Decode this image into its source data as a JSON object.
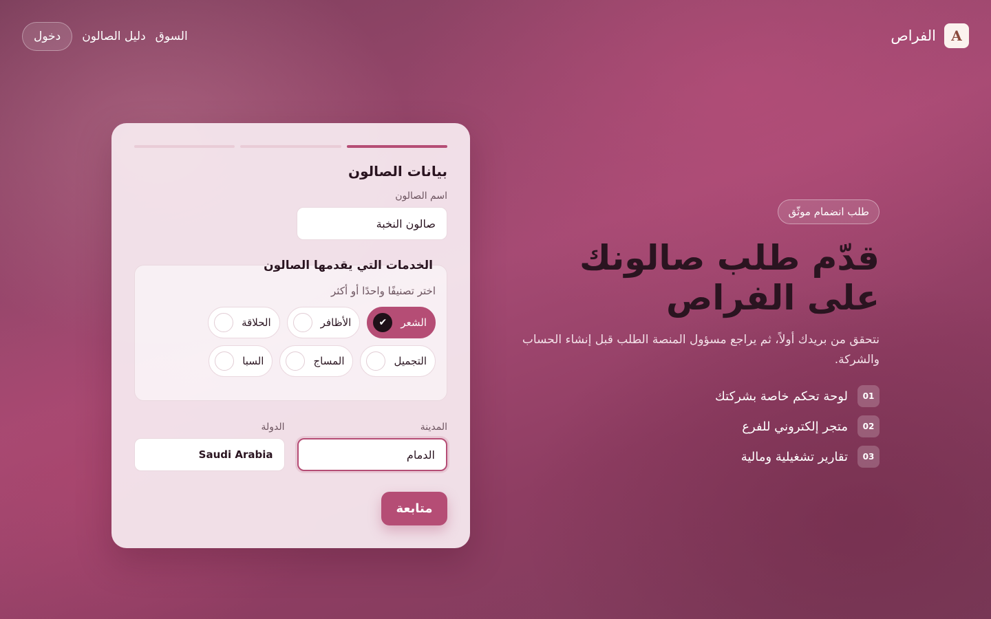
{
  "brand": {
    "name": "الفراص",
    "logo_icon": "brand-monogram-icon"
  },
  "nav": {
    "login_label": "دخول",
    "links": [
      "دليل الصالون",
      "السوق"
    ]
  },
  "hero": {
    "badge": "طلب انضمام موثّق",
    "title": "قدّم طلب صالونك على الفراص",
    "description": "نتحقق من بريدك أولاً، ثم يراجع مسؤول المنصة الطلب قبل إنشاء الحساب والشركة.",
    "features": [
      {
        "num": "01",
        "text": "لوحة تحكم خاصة بشركتك"
      },
      {
        "num": "02",
        "text": "متجر إلكتروني للفرع"
      },
      {
        "num": "03",
        "text": "تقارير تشغيلية ومالية"
      }
    ]
  },
  "form": {
    "steps_total": 3,
    "steps_active": 1,
    "title": "بيانات الصالون",
    "salon_name_label": "اسم الصالون",
    "salon_name_value": "صالون النخبة",
    "services_legend": "الخدمات التي يقدمها الصالون",
    "services_hint": "اختر تصنيفًا واحدًا أو أكثر",
    "services": [
      {
        "label": "الشعر",
        "selected": true
      },
      {
        "label": "الأظافر",
        "selected": false
      },
      {
        "label": "الحلاقة",
        "selected": false
      },
      {
        "label": "التجميل",
        "selected": false
      },
      {
        "label": "المساج",
        "selected": false
      },
      {
        "label": "السبا",
        "selected": false
      }
    ],
    "city_label": "المدينة",
    "city_value": "الدمام",
    "country_label": "الدولة",
    "country_value": "Saudi Arabia",
    "submit_label": "متابعة"
  },
  "colors": {
    "accent": "#b54d75",
    "heading": "#2a1420"
  }
}
